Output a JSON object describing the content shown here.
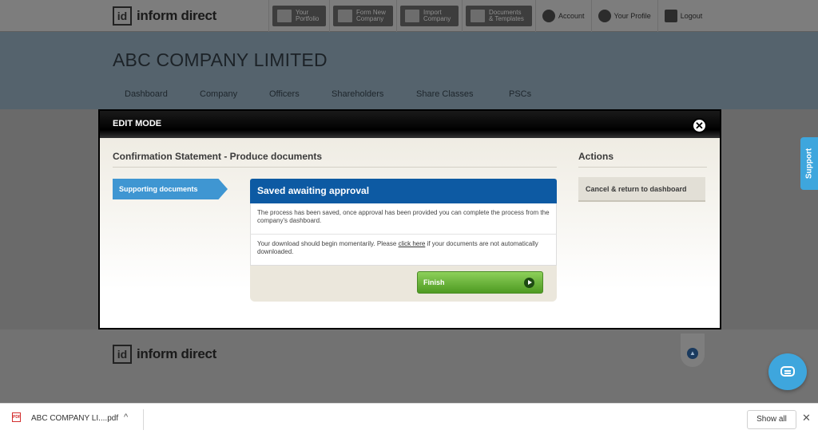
{
  "brand": {
    "logo_mark": "id",
    "logo_text": "inform direct"
  },
  "topnav": {
    "buttons": [
      {
        "label": "Your Portfolio",
        "icon": "grid-icon"
      },
      {
        "label": "Form New Company",
        "icon": "folder-plus-icon"
      },
      {
        "label": "Import Company",
        "icon": "import-icon"
      },
      {
        "label": "Documents & Templates",
        "icon": "documents-icon"
      }
    ],
    "links": [
      {
        "label": "Account",
        "icon": "user-icon"
      },
      {
        "label": "Your Profile",
        "icon": "gear-icon"
      },
      {
        "label": "Logout",
        "icon": "logout-icon"
      }
    ]
  },
  "company": {
    "title": "ABC COMPANY LIMITED"
  },
  "mainnav": {
    "items": [
      "Dashboard",
      "Company",
      "Officers",
      "Shareholders",
      "Share Classes",
      "PSCs"
    ]
  },
  "modal": {
    "header": "EDIT MODE",
    "close_symbol": "✕",
    "section_title": "Confirmation Statement - Produce documents",
    "actions_title": "Actions",
    "step_label": "Supporting documents",
    "panel_title": "Saved awaiting approval",
    "message1": "The process has been saved, once approval has been provided you can complete the process from the company's dashboard.",
    "message2_before": "Your download should begin momentarily. Please ",
    "message2_link": "click here",
    "message2_after": " if your documents are not automatically downloaded.",
    "finish_label": "Finish",
    "cancel_label": "Cancel & return to dashboard"
  },
  "support": {
    "label": "Support"
  },
  "download_bar": {
    "file_icon": "pdf-icon",
    "file_badge": "PDF",
    "file_name": "ABC COMPANY LI....pdf",
    "chevron": "^",
    "show_all_label": "Show all",
    "close_symbol": "✕"
  }
}
